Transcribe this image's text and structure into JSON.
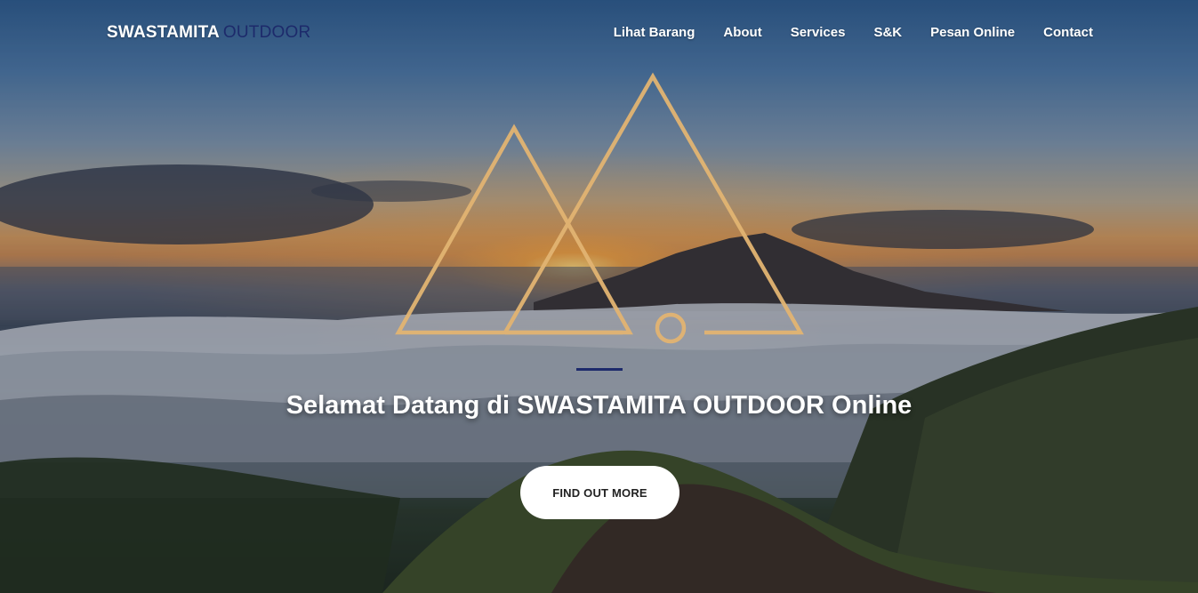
{
  "nav": {
    "brand_primary": "SWASTAMITA",
    "brand_secondary": "OUTDOOR",
    "items": [
      {
        "label": "Lihat Barang"
      },
      {
        "label": "About"
      },
      {
        "label": "Services"
      },
      {
        "label": "S&K"
      },
      {
        "label": "Pesan Online"
      },
      {
        "label": "Contact"
      }
    ]
  },
  "hero": {
    "logo_icon": "mountain-triangles-logo-icon",
    "headline": "Selamat Datang di SWASTAMITA OUTDOOR Online",
    "cta_label": "FIND OUT MORE"
  },
  "colors": {
    "brand_navy": "#1d2a6b",
    "logo_gold": "#e2b472",
    "text_light": "#ffffff",
    "button_bg": "#ffffff"
  }
}
